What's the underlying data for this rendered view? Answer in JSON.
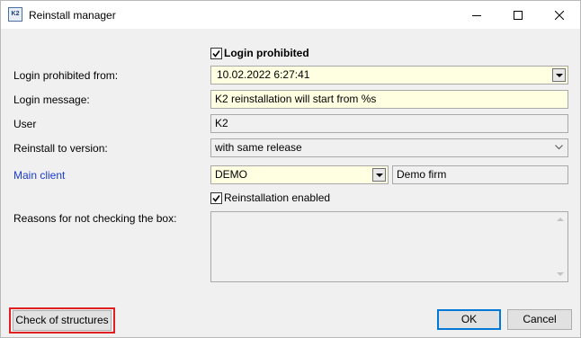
{
  "window": {
    "title": "Reinstall manager",
    "icon_text": "K2",
    "icons": [
      "k2-app-icon",
      "minimize-icon",
      "maximize-icon",
      "close-icon"
    ]
  },
  "form": {
    "login_prohibited": {
      "label": "Login prohibited",
      "checked": true
    },
    "login_prohibited_from": {
      "label": "Login prohibited from:",
      "value": "10.02.2022  6:27:41"
    },
    "login_message": {
      "label": "Login message:",
      "value": "K2 reinstallation will start from %s"
    },
    "user": {
      "label": "User",
      "value": "K2"
    },
    "reinstall_to_version": {
      "label": "Reinstall to version:",
      "value": "with same release"
    },
    "main_client": {
      "label": "Main client",
      "value": "DEMO",
      "description": "Demo firm"
    },
    "reinstallation_enabled": {
      "label": "Reinstallation enabled",
      "checked": true
    },
    "reasons": {
      "label": "Reasons for not checking the box:",
      "value": ""
    }
  },
  "buttons": {
    "check_structures": "Check of structures",
    "ok": "OK",
    "cancel": "Cancel"
  },
  "colors": {
    "field_yellow": "#ffffe1",
    "link_blue": "#1a3ccc",
    "default_button_border": "#0078d7",
    "highlight_red": "#e02020"
  }
}
